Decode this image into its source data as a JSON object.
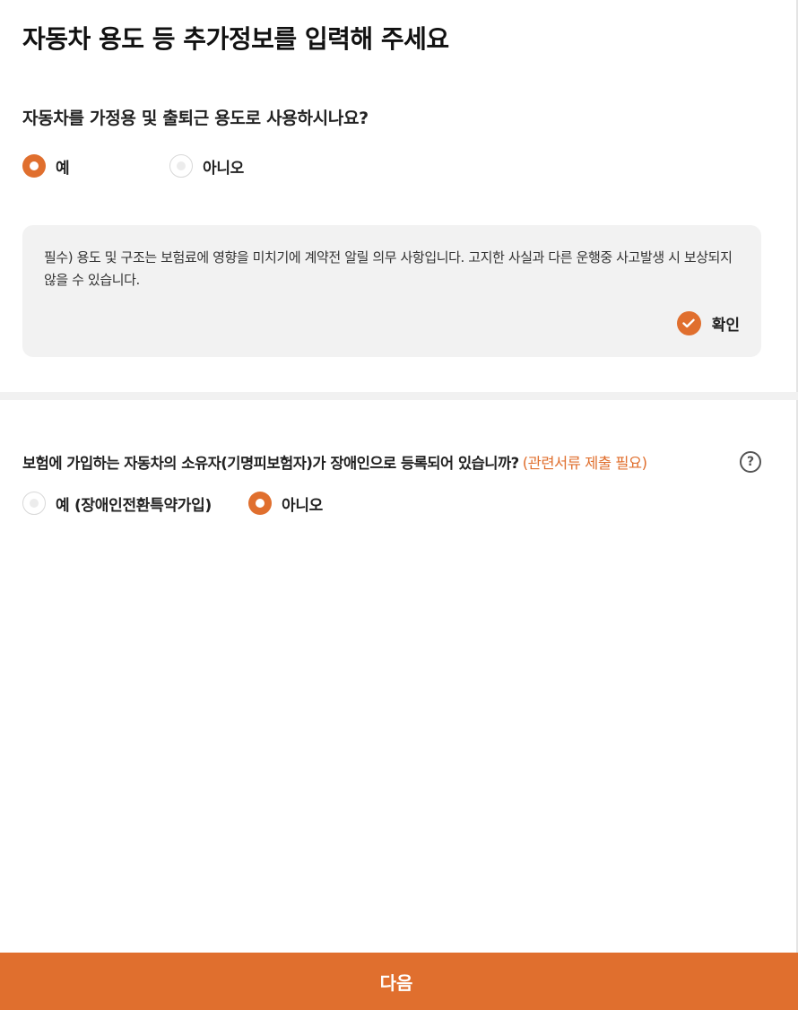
{
  "page": {
    "title": "자동차 용도 등 추가정보를 입력해 주세요"
  },
  "question1": {
    "text": "자동차를 가정용 및 출퇴근 용도로 사용하시나요?",
    "options": [
      {
        "label": "예",
        "selected": true
      },
      {
        "label": "아니오",
        "selected": false
      }
    ]
  },
  "notice": {
    "text": "필수) 용도 및 구조는 보험료에 영향을 미치기에 계약전 알릴 의무 사항입니다. 고지한 사실과 다른 운행중 사고발생 시 보상되지 않을 수 있습니다.",
    "confirm_label": "확인",
    "confirm_icon": "check-icon",
    "confirmed": true
  },
  "question2": {
    "text": "보험에 가입하는 자동차의 소유자(기명피보험자)가 장애인으로 등록되어 있습니까?",
    "note": "(관련서류 제출 필요)",
    "help_icon": "question-circle-icon",
    "help_glyph": "?",
    "options": [
      {
        "label": "예 (장애인전환특약가입)",
        "selected": false
      },
      {
        "label": "아니오",
        "selected": true
      }
    ]
  },
  "footer": {
    "next_label": "다음"
  },
  "colors": {
    "accent": "#e06f2e",
    "panel_bg": "#f2f2f2",
    "text": "#222222"
  }
}
